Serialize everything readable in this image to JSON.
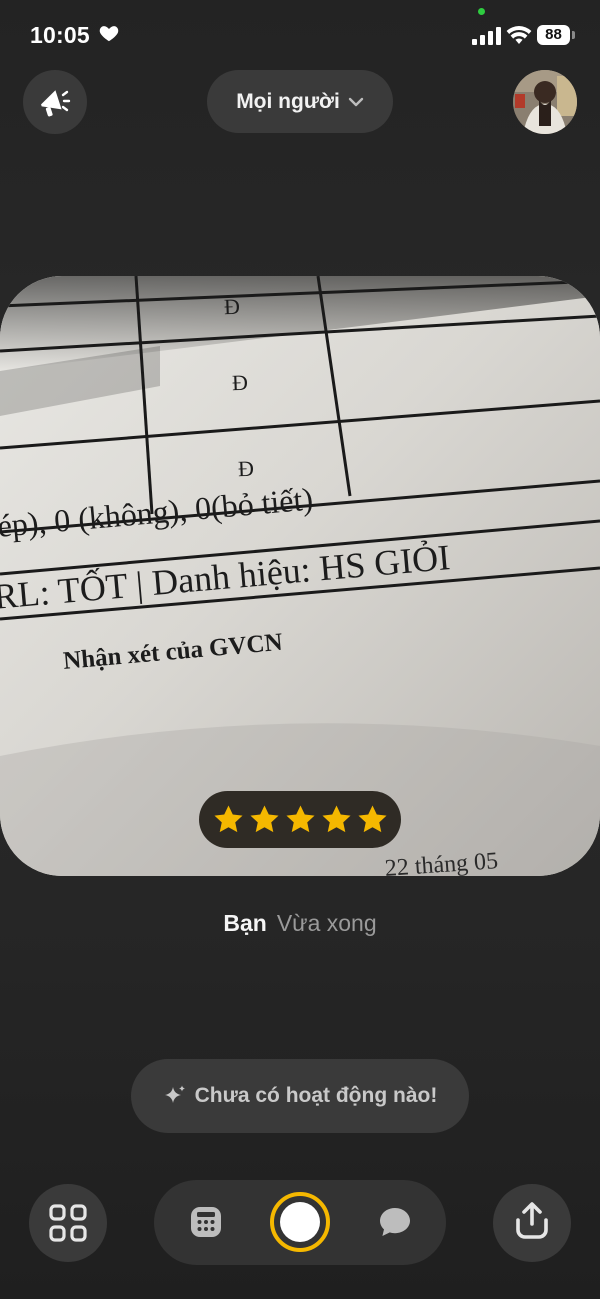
{
  "status_bar": {
    "time": "10:05",
    "battery": "88"
  },
  "header": {
    "audience_label": "Mọi người"
  },
  "photo": {
    "table_marks": [
      "Đ",
      "Đ",
      "Đ"
    ],
    "line1": "ép), 0 (không), 0(bỏ tiết)",
    "line2": "RL: TỐT | Danh hiệu: HS GIỎI",
    "line3": "Nhận xét của GVCN",
    "line4": "22 tháng 05",
    "rating": 5
  },
  "caption": {
    "user": "Bạn",
    "time": "Vừa xong"
  },
  "activity": {
    "text": "Chưa có hoạt động nào!"
  },
  "colors": {
    "accent_yellow": "#f5b800",
    "pill_bg": "#3a3a3a",
    "background": "#262626"
  }
}
